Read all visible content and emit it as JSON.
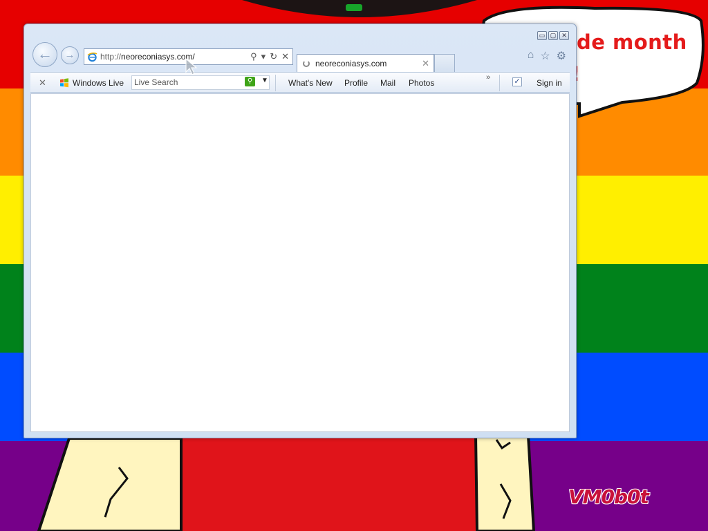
{
  "desktop": {
    "bubble_text_line1": "de month",
    "bubble_text_line2": "!",
    "watermark": "VM0b0t"
  },
  "browser": {
    "window_controls": {
      "minimize": "▭",
      "maximize": "▢",
      "close": "✕"
    },
    "nav": {
      "back_icon": "←",
      "forward_icon": "→"
    },
    "address": {
      "url_prefix": "http://",
      "url_host": "neoreconiasys.com/",
      "search_icon": "⚲",
      "dropdown_icon": "▾",
      "refresh_icon": "↻",
      "stop_icon": "✕"
    },
    "tabs": [
      {
        "title": "neoreconiasys.com",
        "close": "✕"
      }
    ],
    "right_icons": {
      "home": "⌂",
      "favorites": "☆",
      "tools": "⚙"
    },
    "toolbar": {
      "close": "✕",
      "brand": "Windows Live",
      "search_placeholder": "Live Search",
      "search_go": "⚲",
      "search_drop": "▼",
      "links": [
        "What's New",
        "Profile",
        "Mail",
        "Photos"
      ],
      "more": "»",
      "check": "✓",
      "sign_in": "Sign in"
    }
  },
  "colors": {
    "rainbow": [
      "#e60000",
      "#ff8b00",
      "#ffef00",
      "#00821b",
      "#004cff",
      "#760089"
    ],
    "bubble_text": "#e41b1b",
    "watermark": "#c8103a"
  }
}
